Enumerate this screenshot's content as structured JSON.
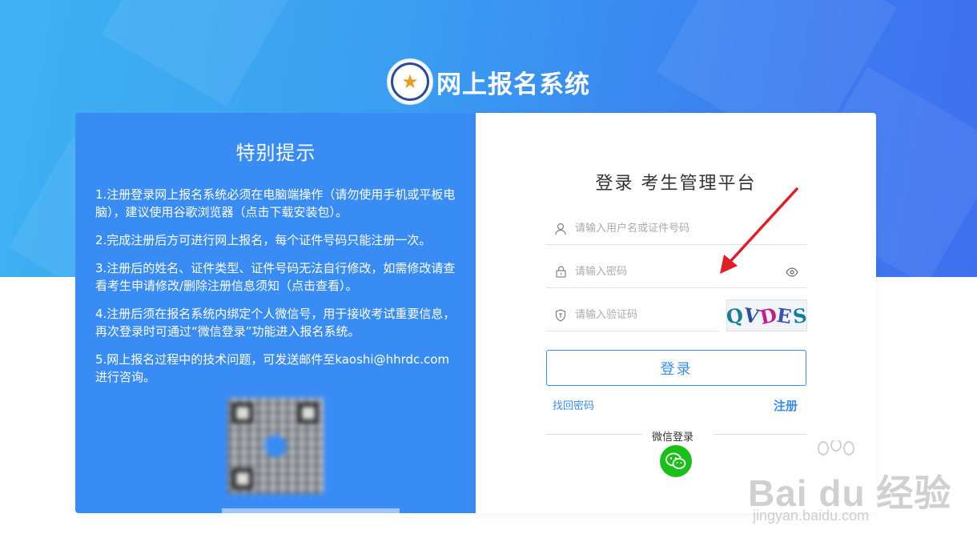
{
  "header": {
    "site_title": "网上报名系统"
  },
  "notice": {
    "title": "特别提示",
    "items": [
      "1.注册登录网上报名系统必须在电脑端操作（请勿使用手机或平板电脑），建议使用谷歌浏览器（点击下载安装包）。",
      "2.完成注册后方可进行网上报名，每个证件号码只能注册一次。",
      "3.注册后的姓名、证件类型、证件号码无法自行修改，如需修改请查看考生申请修改/删除注册信息须知（点击查看）。",
      "4.注册后须在报名系统内绑定个人微信号，用于接收考试重要信息，再次登录时可通过“微信登录”功能进入报名系统。",
      "5.网上报名过程中的技术问题，可发送邮件至kaoshi@hhrdc.com进行咨询。"
    ]
  },
  "login": {
    "title": "登录 考生管理平台",
    "username_placeholder": "请输入用户名或证件号码",
    "password_placeholder": "请输入密码",
    "captcha_placeholder": "请输入验证码",
    "captcha_text": [
      "Q",
      "V",
      "D",
      "E",
      "S"
    ],
    "login_button": "登录",
    "forgot_link": "找回密码",
    "register_link": "注册",
    "wechat_label": "微信登录"
  },
  "watermark": {
    "main": "Bai du 经验",
    "sub": "jingyan.baidu.com"
  },
  "colors": {
    "primary": "#3a8cf5",
    "wechat": "#1bbf19",
    "arrow": "#e01e25"
  }
}
